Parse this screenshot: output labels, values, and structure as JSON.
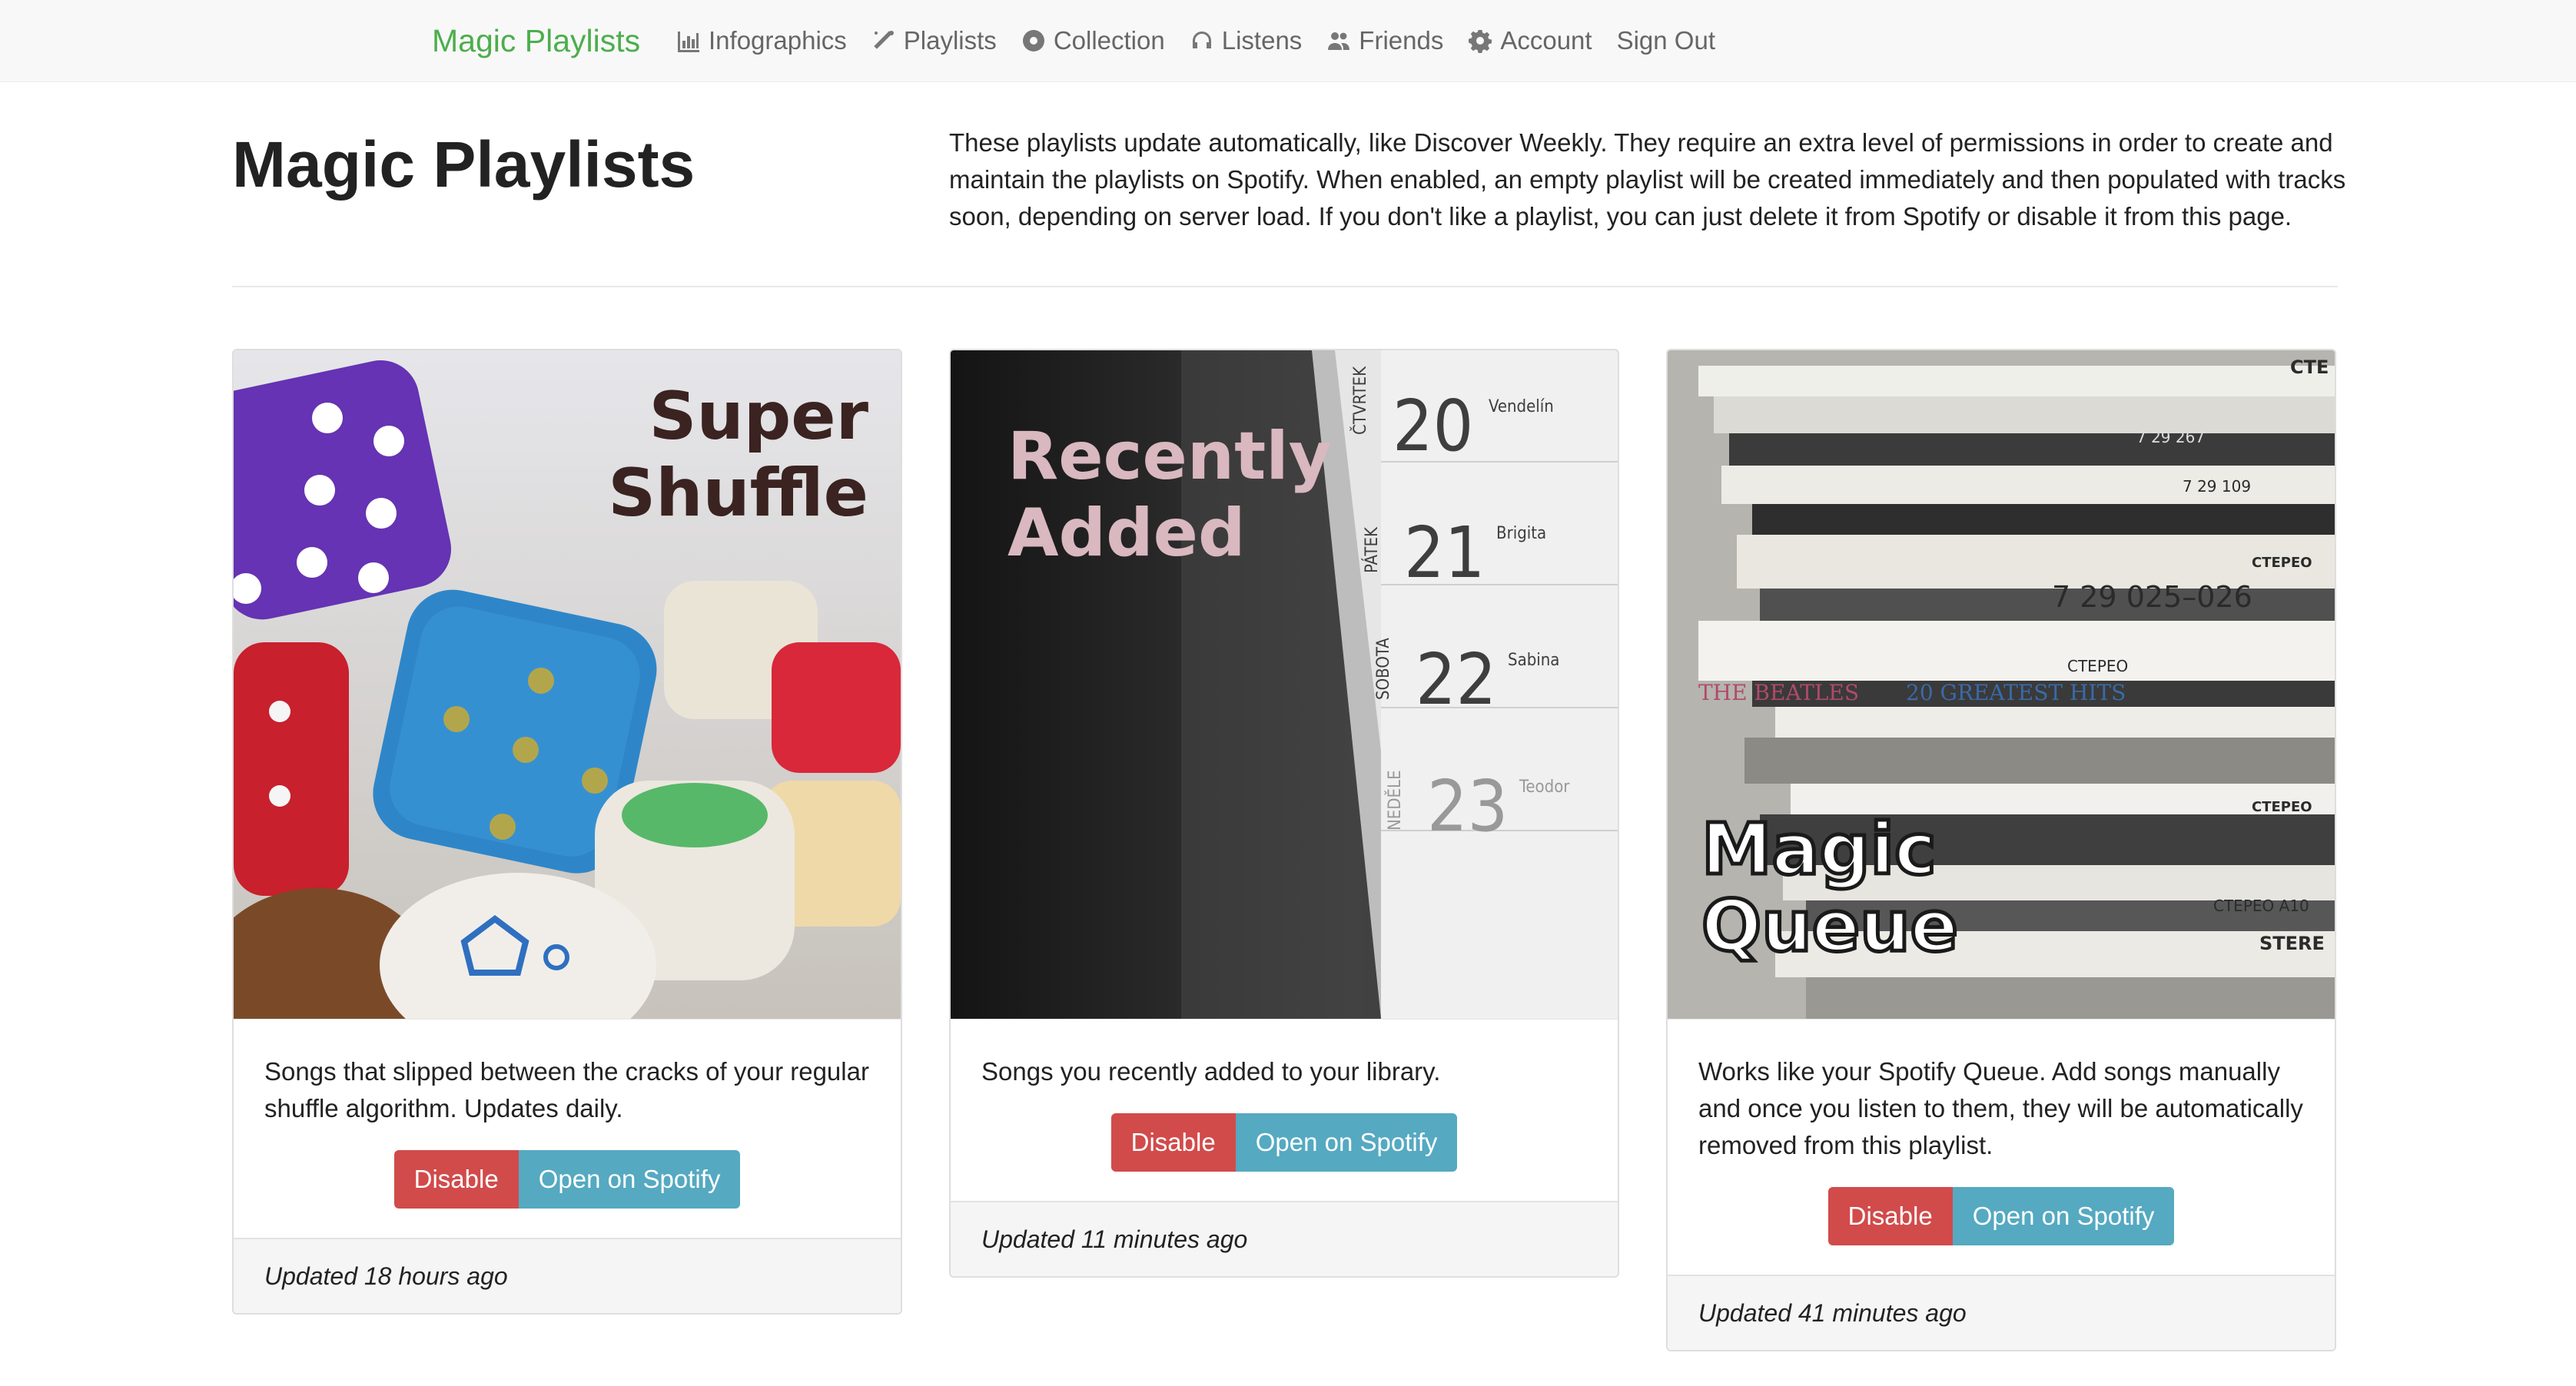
{
  "navbar": {
    "brand": "Magic Playlists",
    "items": [
      {
        "label": "Infographics",
        "icon": "bar-chart-icon"
      },
      {
        "label": "Playlists",
        "icon": "magic-wand-icon"
      },
      {
        "label": "Collection",
        "icon": "disc-icon"
      },
      {
        "label": "Listens",
        "icon": "headphones-icon"
      },
      {
        "label": "Friends",
        "icon": "users-icon"
      },
      {
        "label": "Account",
        "icon": "gear-icon"
      }
    ],
    "sign_out": "Sign Out"
  },
  "header": {
    "title": "Magic Playlists",
    "intro": "These playlists update automatically, like Discover Weekly. They require an extra level of permissions in order to create and maintain the playlists on Spotify. When enabled, an empty playlist will be created immediately and then populated with tracks soon, depending on server load. If you don't like a playlist, you can just delete it from Spotify or disable it from this page."
  },
  "cards": [
    {
      "title_line1": "Super",
      "title_line2": "Shuffle",
      "image": "dice-photo",
      "description": "Songs that slipped between the cracks of your regular shuffle algorithm. Updates daily.",
      "disable_label": "Disable",
      "open_label": "Open on Spotify",
      "updated": "Updated 18 hours ago"
    },
    {
      "title_line1": "Recently",
      "title_line2": "Added",
      "image": "calendar-photo",
      "calendar": [
        {
          "day": "ČTVRTEK",
          "num": "20",
          "name": "Vendelín"
        },
        {
          "day": "PÁTEK",
          "num": "21",
          "name": "Brigita"
        },
        {
          "day": "SOBOTA",
          "num": "22",
          "name": "Sabina"
        },
        {
          "day": "NEDĚLE",
          "num": "23",
          "name": "Teodor"
        }
      ],
      "description": "Songs you recently added to your library.",
      "disable_label": "Disable",
      "open_label": "Open on Spotify",
      "updated": "Updated 11 minutes ago"
    },
    {
      "title_line1": "Magic",
      "title_line2": "Queue",
      "image": "record-stack-photo",
      "record_labels": [
        "СТЕ",
        "7 29 267",
        "7 29 109",
        "СТЕРЕО",
        "7 29 025–026",
        "СТЕРЕО",
        "THE BEATLES",
        "20 GREATEST HITS",
        "СТЕРЕО",
        "СТЕРЕО А10",
        "STERE"
      ],
      "description": "Works like your Spotify Queue. Add songs manually and once you listen to them, they will be automatically removed from this playlist.",
      "disable_label": "Disable",
      "open_label": "Open on Spotify",
      "updated": "Updated 41 minutes ago"
    }
  ],
  "colors": {
    "brand": "#4cae4c",
    "danger": "#d14b4b",
    "info": "#55a9c1"
  }
}
